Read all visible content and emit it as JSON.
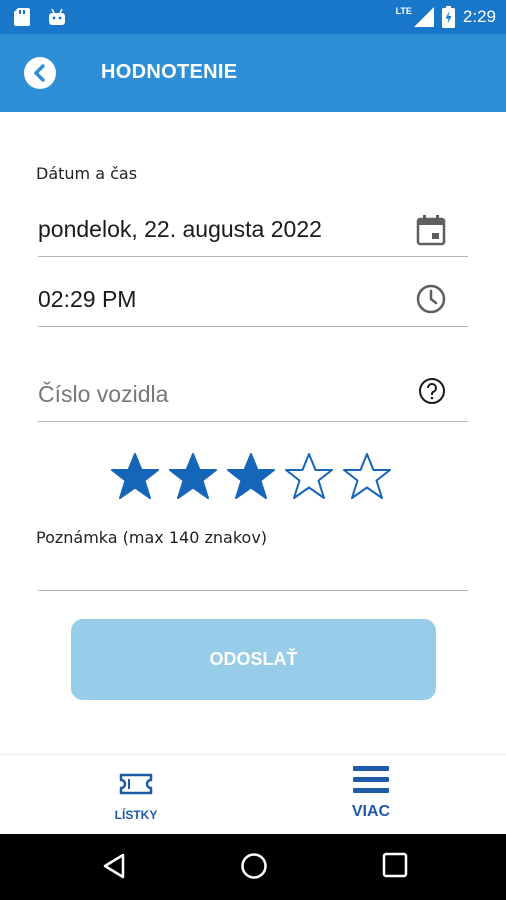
{
  "status_bar": {
    "time": "2:29",
    "network": "LTE"
  },
  "app_bar": {
    "title": "HODNOTENIE",
    "back_icon": "chevron-left-circle-icon"
  },
  "form": {
    "datetime_label": "Dátum a čas",
    "date_value": "pondelok, 22. augusta 2022",
    "time_value": "02:29 PM",
    "vehicle_placeholder": "Číslo vozidla",
    "rating": {
      "value": 3,
      "max": 5
    },
    "note_label": "Poznámka (max 140 znakov)",
    "note_value": "",
    "submit_label": "ODOSLAŤ"
  },
  "bottom_nav": {
    "items": [
      {
        "label": "LÍSTKY",
        "icon": "ticket-icon"
      },
      {
        "label": "VIAC",
        "icon": "menu-icon"
      }
    ]
  },
  "colors": {
    "status_bar": "#1877c8",
    "app_bar": "#2e8fd6",
    "star": "#1565b8",
    "submit_disabled": "#98cdea",
    "nav_text": "#1e5aa8"
  }
}
